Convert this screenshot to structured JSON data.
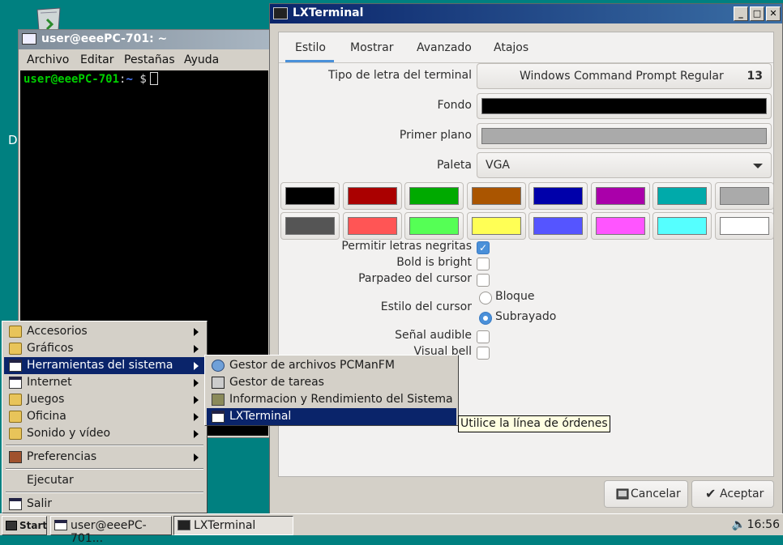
{
  "terminal_window": {
    "title": "user@eeePC-701: ~",
    "menu": [
      "Archivo",
      "Editar",
      "Pestañas",
      "Ayuda"
    ],
    "prompt_user": "user@eeePC-701",
    "prompt_sep": ":",
    "prompt_dir": "~",
    "prompt_dollar": "$"
  },
  "desktop": {
    "partial_label": "D"
  },
  "dialog": {
    "title": "LXTerminal",
    "window_buttons": [
      "_",
      "□",
      "✕"
    ],
    "tabs": [
      "Estilo",
      "Mostrar",
      "Avanzado",
      "Atajos"
    ],
    "active_tab": "Estilo",
    "font_label": "Tipo de letra del terminal",
    "font_name": "Windows Command Prompt Regular",
    "font_size": "13",
    "background_label": "Fondo",
    "background_color": "#000000",
    "foreground_label": "Primer plano",
    "foreground_color": "#aaaaaa",
    "palette_label": "Paleta",
    "palette_value": "VGA",
    "palette_colors": [
      [
        "#000000",
        "#aa0000",
        "#00aa00",
        "#aa5500",
        "#0000aa",
        "#aa00aa",
        "#00aaaa",
        "#aaaaaa"
      ],
      [
        "#555555",
        "#ff5555",
        "#55ff55",
        "#ffff55",
        "#5555ff",
        "#ff55ff",
        "#55ffff",
        "#ffffff"
      ]
    ],
    "allow_bold_label": "Permitir letras negritas",
    "allow_bold": true,
    "bold_bright_label": "Bold is bright",
    "bold_bright": false,
    "cursor_blink_label": "Parpadeo del cursor",
    "cursor_blink": false,
    "cursor_style_label": "Estilo del cursor",
    "cursor_style_options": [
      "Bloque",
      "Subrayado"
    ],
    "cursor_style_selected": "Subrayado",
    "audible_bell_label": "Señal audible",
    "audible_bell": false,
    "visual_bell_label": "Visual bell",
    "visual_bell": false,
    "cancel_label": "Cancelar",
    "ok_label": "Aceptar"
  },
  "start_menu": {
    "items": [
      {
        "label": "Accesorios",
        "submenu": true,
        "icon": "folder-icon"
      },
      {
        "label": "Gráficos",
        "submenu": true,
        "icon": "folder-icon"
      },
      {
        "label": "Herramientas del sistema",
        "submenu": true,
        "icon": "window-icon",
        "selected": true
      },
      {
        "label": "Internet",
        "submenu": true,
        "icon": "window-icon"
      },
      {
        "label": "Juegos",
        "submenu": true,
        "icon": "folder-icon"
      },
      {
        "label": "Oficina",
        "submenu": true,
        "icon": "folder-icon"
      },
      {
        "label": "Sonido y vídeo",
        "submenu": true,
        "icon": "folder-icon"
      },
      {
        "label": "Preferencias",
        "submenu": true,
        "icon": "preferences-icon"
      },
      {
        "label": "Ejecutar",
        "submenu": false,
        "icon": ""
      },
      {
        "label": "Salir",
        "submenu": false,
        "icon": "window-icon"
      }
    ]
  },
  "submenu": {
    "items": [
      {
        "label": "Gestor de archivos PCManFM",
        "icon": "file-manager-icon"
      },
      {
        "label": "Gestor de tareas",
        "icon": "task-manager-icon"
      },
      {
        "label": "Informacion y Rendimiento del Sistema",
        "icon": "system-info-icon"
      },
      {
        "label": "LXTerminal",
        "icon": "terminal-icon",
        "selected": true
      }
    ]
  },
  "tooltip": "Utilice la línea de órdenes",
  "taskbar": {
    "start_label": "Start",
    "tasks": [
      "user@eeePC-701...",
      "LXTerminal"
    ],
    "clock": "16:56"
  }
}
